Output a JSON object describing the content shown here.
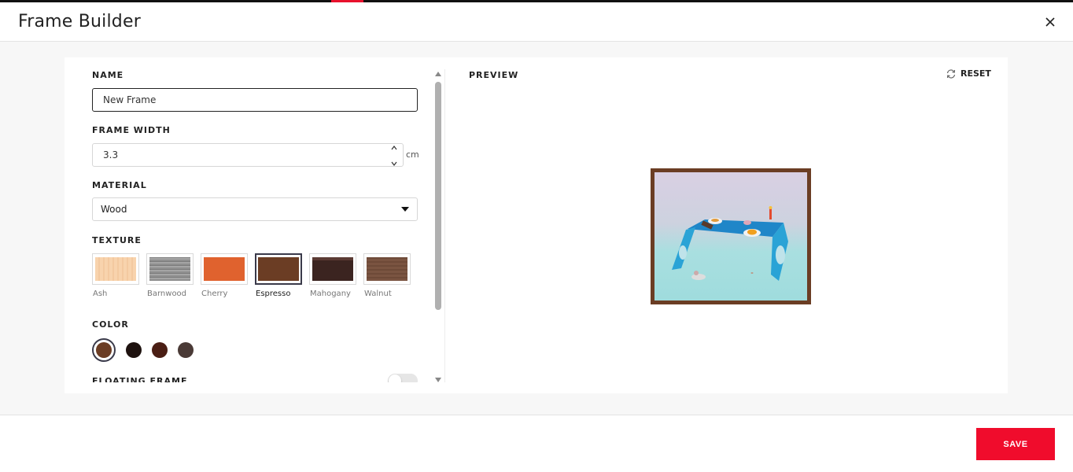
{
  "header": {
    "title": "Frame Builder",
    "close_icon": "close-icon"
  },
  "form": {
    "name_label": "NAME",
    "name_value": "New Frame",
    "width_label": "FRAME WIDTH",
    "width_value": "3.3",
    "width_unit": "cm",
    "material_label": "MATERIAL",
    "material_value": "Wood",
    "texture_label": "TEXTURE",
    "textures": [
      {
        "label": "Ash",
        "color": "#f8d3ad"
      },
      {
        "label": "Barnwood",
        "color": "#8f8f8f"
      },
      {
        "label": "Cherry",
        "color": "#e0622e"
      },
      {
        "label": "Espresso",
        "color": "#6b3d24",
        "selected": true
      },
      {
        "label": "Mahogany",
        "color": "#3b2420"
      },
      {
        "label": "Walnut",
        "color": "#7a5441"
      }
    ],
    "color_label": "COLOR",
    "colors": [
      "#6b3d24",
      "#1e120f",
      "#4a1e14",
      "#4a3a36"
    ],
    "floating_label": "FLOATING FRAME"
  },
  "preview": {
    "label": "PREVIEW",
    "reset_label": "RESET"
  },
  "footer": {
    "save_label": "SAVE"
  },
  "accent_color": "#f00c2c"
}
